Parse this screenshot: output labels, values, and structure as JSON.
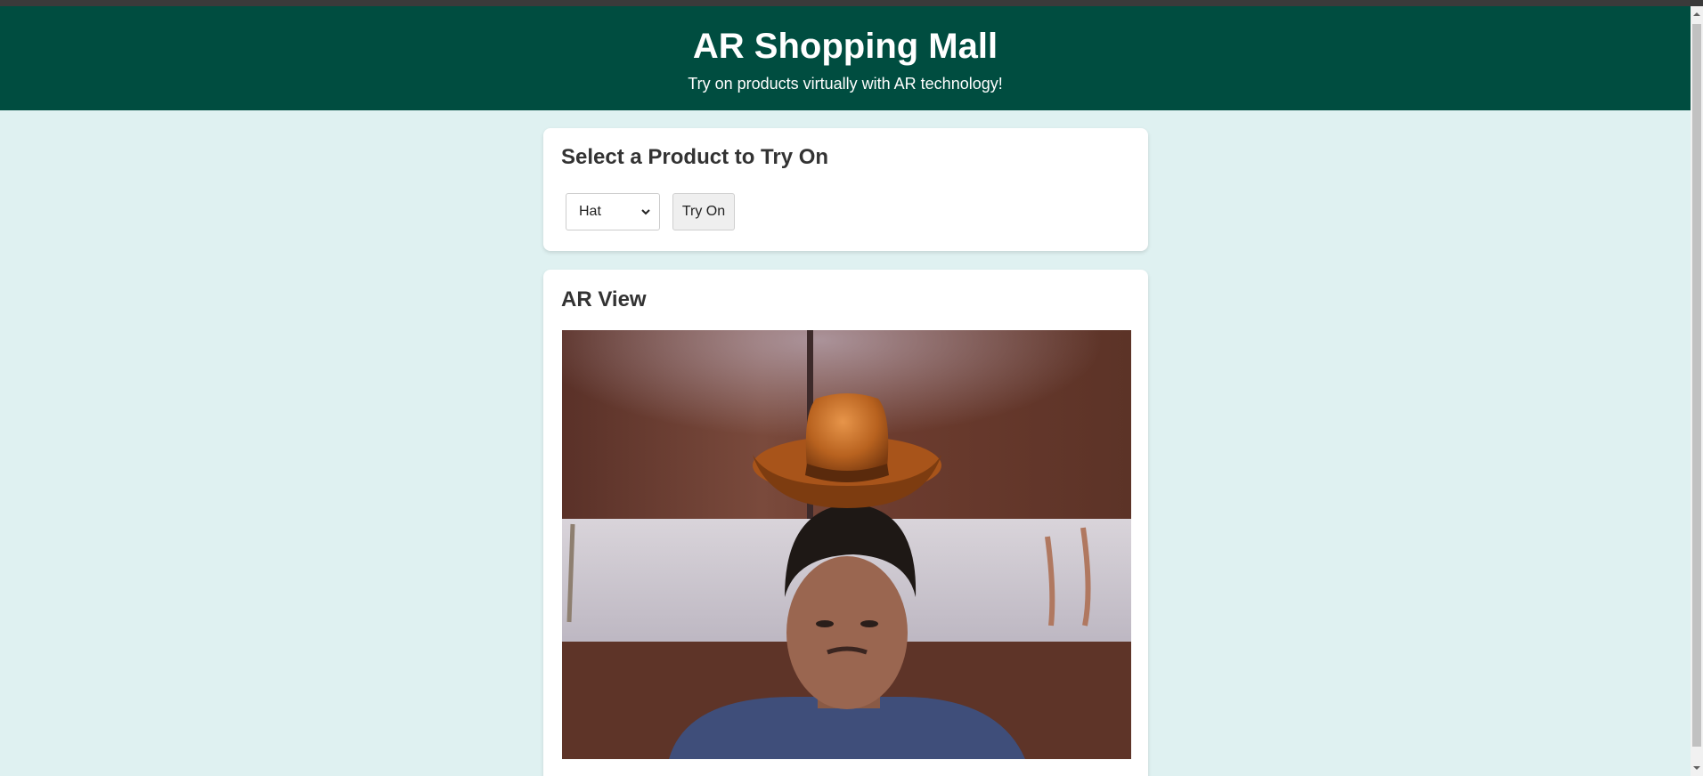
{
  "header": {
    "title": "AR Shopping Mall",
    "subtitle": "Try on products virtually with AR technology!"
  },
  "product_section": {
    "heading": "Select a Product to Try On",
    "select_value": "Hat",
    "button_label": "Try On"
  },
  "ar_section": {
    "heading": "AR View"
  },
  "colors": {
    "header_bg": "#004d40",
    "page_bg": "#dff1f1",
    "card_bg": "#ffffff",
    "heading_text": "#333333"
  },
  "icons": {
    "select_arrow": "chevron-down-icon"
  }
}
